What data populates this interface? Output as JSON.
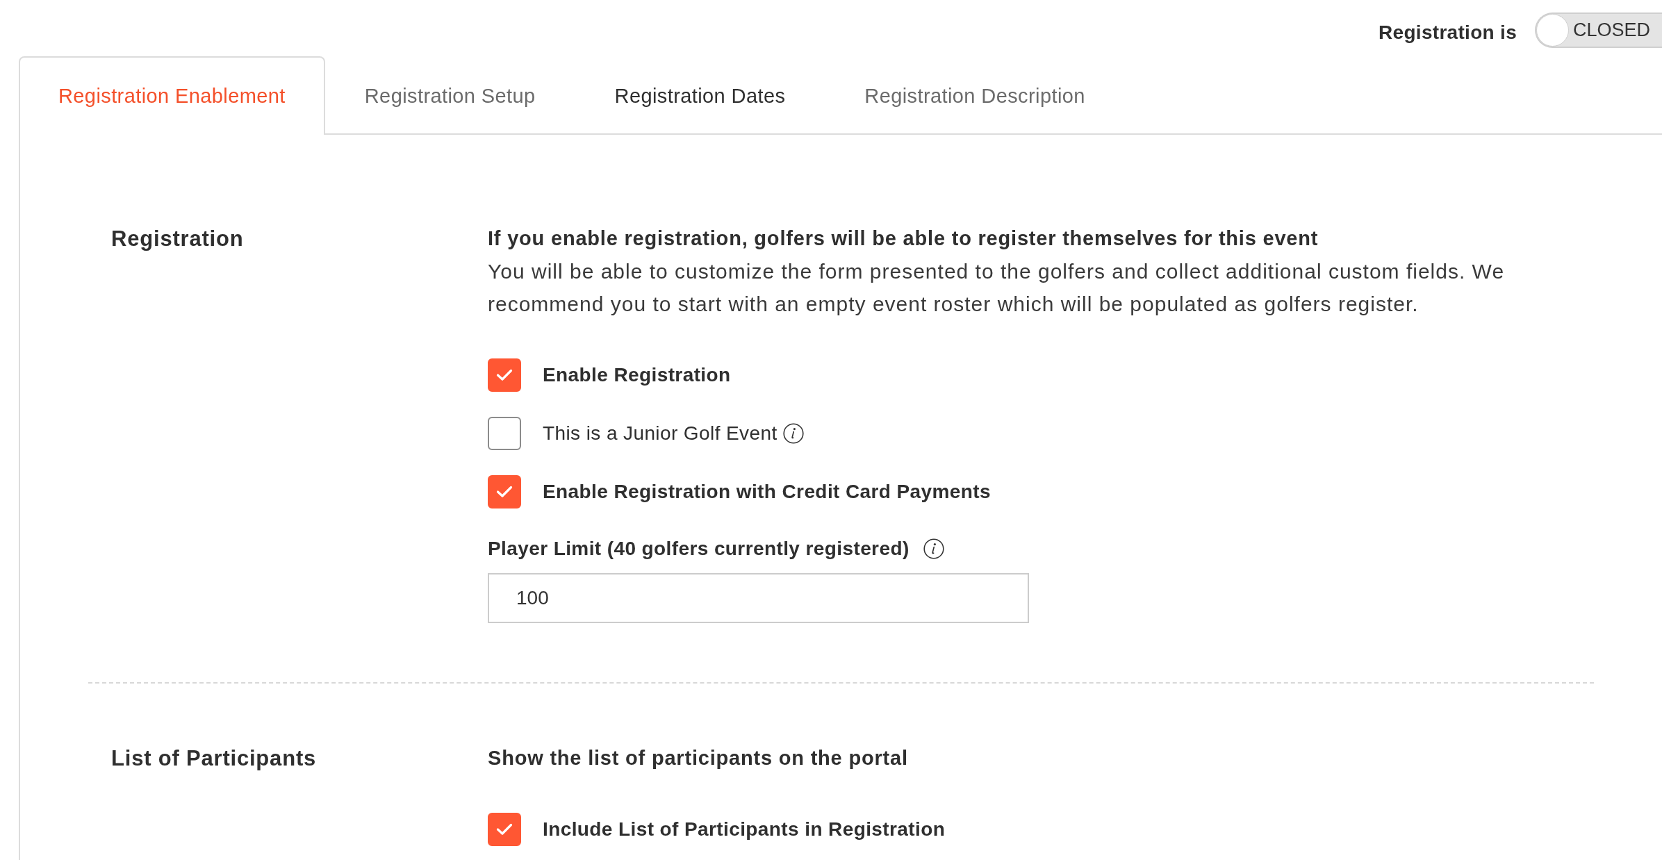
{
  "status": {
    "label": "Registration is",
    "toggle": {
      "on": false,
      "text": "CLOSED"
    }
  },
  "tabs": [
    {
      "label": "Registration Enablement",
      "selected": true,
      "hovered": false
    },
    {
      "label": "Registration Setup",
      "selected": false,
      "hovered": false
    },
    {
      "label": "Registration Dates",
      "selected": false,
      "hovered": true
    },
    {
      "label": "Registration Description",
      "selected": false,
      "hovered": false
    }
  ],
  "sections": [
    {
      "title": "Registration",
      "heading": "If you enable registration, golfers will be able to register themselves for this event",
      "description": "You will be able to customize the form presented to the golfers and collect additional custom fields. We recommend you to start with an empty event roster which will be populated as golfers register.",
      "options": [
        {
          "label": "Enable Registration",
          "checked": true
        },
        {
          "label": "This is a Junior Golf Event",
          "checked": false,
          "info": true
        },
        {
          "label": "Enable Registration with Credit Card Payments",
          "checked": true
        }
      ],
      "field": {
        "label": "Player Limit (40 golfers currently registered)",
        "info": true,
        "value": "100"
      }
    },
    {
      "title": "List of Participants",
      "heading": "Show the list of participants on the portal",
      "options": [
        {
          "label": "Include List of Participants in Registration",
          "checked": true
        }
      ]
    }
  ]
}
